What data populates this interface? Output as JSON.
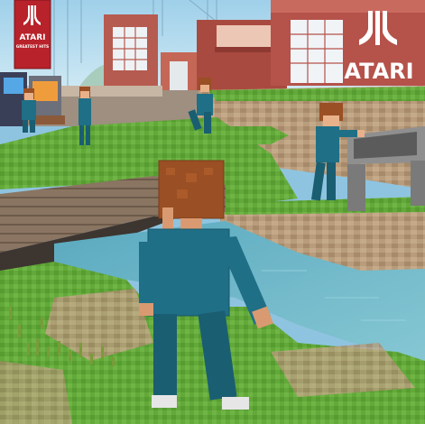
{
  "banners": {
    "left": {
      "brand": "ATARI",
      "tagline": "GREATEST HITS",
      "logo_icon": "atari-fuji-icon",
      "color": "#b8222a"
    },
    "right": {
      "brand": "ATARI",
      "logo_icon": "atari-fuji-icon",
      "color": "#b8222a"
    }
  },
  "palette": {
    "sky": "#8fc4e0",
    "grass": "#5ea336",
    "stone": "#b39878",
    "water": "#6fb7c8",
    "avatar_suit": "#1f6f86",
    "avatar_hair": "#8a4a22"
  },
  "characters": {
    "player": {
      "icon": "player-avatar"
    },
    "npcs": [
      "npc-at-arcade",
      "npc-near-arcade",
      "npc-on-upper-ledge",
      "npc-near-table"
    ]
  }
}
